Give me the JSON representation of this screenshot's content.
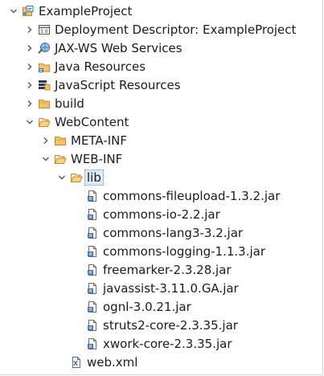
{
  "tree": {
    "root": {
      "label": "ExampleProject",
      "icon": "project-icon",
      "expanded": true
    },
    "nodes": [
      {
        "label": "Deployment Descriptor: ExampleProject",
        "icon": "deployment-descriptor-icon",
        "expanded": false
      },
      {
        "label": "JAX-WS Web Services",
        "icon": "web-services-icon",
        "expanded": false
      },
      {
        "label": "Java Resources",
        "icon": "java-resources-icon",
        "expanded": false
      },
      {
        "label": "JavaScript Resources",
        "icon": "javascript-resources-icon",
        "expanded": false
      },
      {
        "label": "build",
        "icon": "folder-icon",
        "expanded": false
      },
      {
        "label": "WebContent",
        "icon": "folder-icon",
        "expanded": true
      },
      {
        "label": "META-INF",
        "icon": "folder-icon",
        "expanded": false
      },
      {
        "label": "WEB-INF",
        "icon": "folder-icon",
        "expanded": true
      },
      {
        "label": "lib",
        "icon": "folder-icon",
        "expanded": true,
        "selected": true
      }
    ],
    "jars": [
      "commons-fileupload-1.3.2.jar",
      "commons-io-2.2.jar",
      "commons-lang3-3.2.jar",
      "commons-logging-1.1.3.jar",
      "freemarker-2.3.28.jar",
      "javassist-3.11.0.GA.jar",
      "ognl-3.0.21.jar",
      "struts2-core-2.3.35.jar",
      "xwork-core-2.3.35.jar"
    ],
    "web_xml": {
      "label": "web.xml",
      "icon": "xml-file-icon"
    }
  },
  "colors": {
    "folder_fill": "#f2c46a",
    "folder_stroke": "#c08a2e",
    "chevron": "#555555",
    "selection_bg": "#dbe8f6"
  }
}
